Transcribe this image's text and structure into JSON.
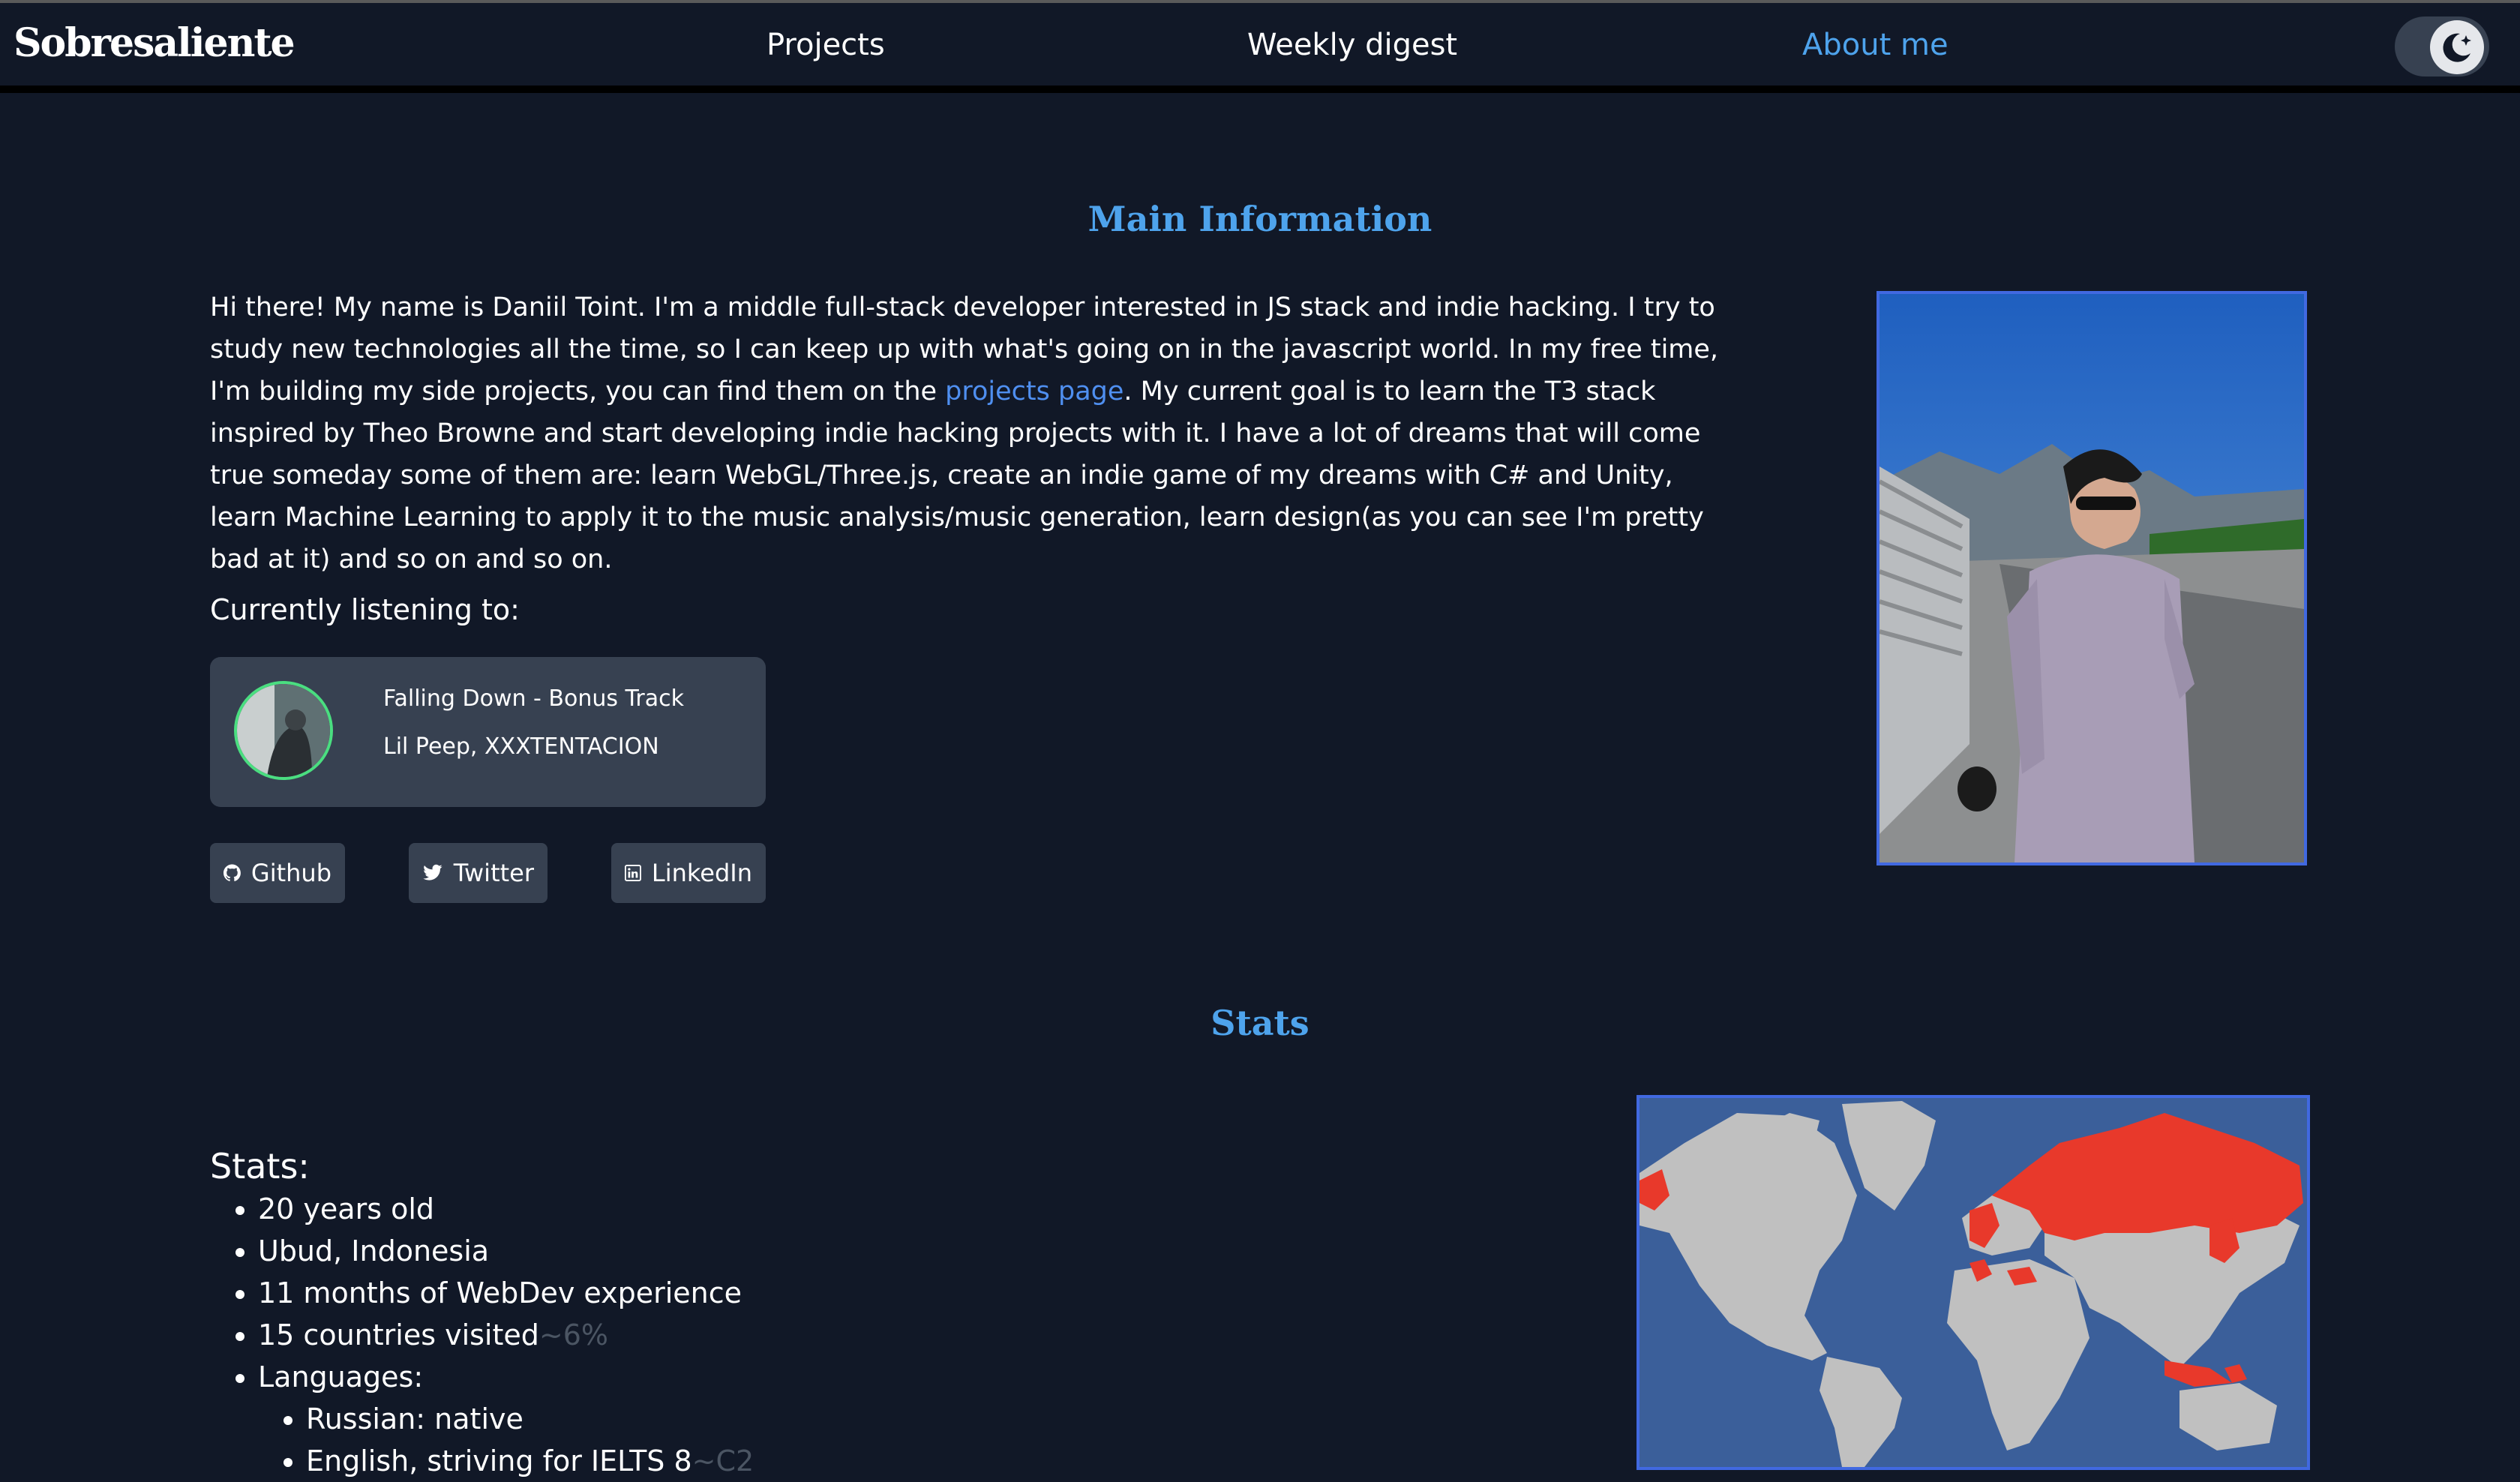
{
  "header": {
    "logo": "Sobresaliente",
    "nav": [
      {
        "label": "Projects"
      },
      {
        "label": "Weekly digest"
      },
      {
        "label": "About me"
      }
    ],
    "active_nav": "About me"
  },
  "main_info": {
    "heading": "Main Information",
    "intro_before_link": "Hi there! My name is Daniil Toint. I'm a middle full-stack developer interested in JS stack and indie hacking. I try to study new technologies all the time, so I can keep up with what's going on in the javascript world. In my free time, I'm building my side projects, you can find them on the ",
    "intro_link": "projects page",
    "intro_after_link": ". My current goal is to learn the T3 stack inspired by Theo Browne and start developing indie hacking projects with it. I have a lot of dreams that will come true someday some of them are: learn WebGL/Three.js, create an indie game of my dreams with C# and Unity, learn Machine Learning to apply it to the music analysis/music generation, learn design(as you can see I'm pretty bad at it) and so on and so on.",
    "listening_label": "Currently listening to:",
    "track": {
      "title": "Falling Down - Bonus Track",
      "artist": "Lil Peep, XXXTENTACION"
    },
    "socials": [
      {
        "label": "Github",
        "icon": "github-icon"
      },
      {
        "label": "Twitter",
        "icon": "twitter-icon"
      },
      {
        "label": "LinkedIn",
        "icon": "linkedin-icon"
      }
    ]
  },
  "stats": {
    "heading": "Stats",
    "subheading": "Stats:",
    "items": [
      {
        "text": "20 years old"
      },
      {
        "text": "Ubud, Indonesia"
      },
      {
        "text": "11 months of WebDev experience"
      },
      {
        "text": "15 countries visited",
        "note": "~6%"
      },
      {
        "text": "Languages:"
      }
    ],
    "languages": [
      {
        "text": "Russian: native"
      },
      {
        "text": "English, striving for IELTS 8",
        "note": "~C2"
      }
    ]
  },
  "colors": {
    "background": "#111827",
    "accent": "#4ea3ec",
    "link": "#4f8ff0",
    "card": "#374151",
    "map_ocean": "#3b5f9a",
    "map_land": "#c0c0c0",
    "map_visited": "#e8392b"
  }
}
